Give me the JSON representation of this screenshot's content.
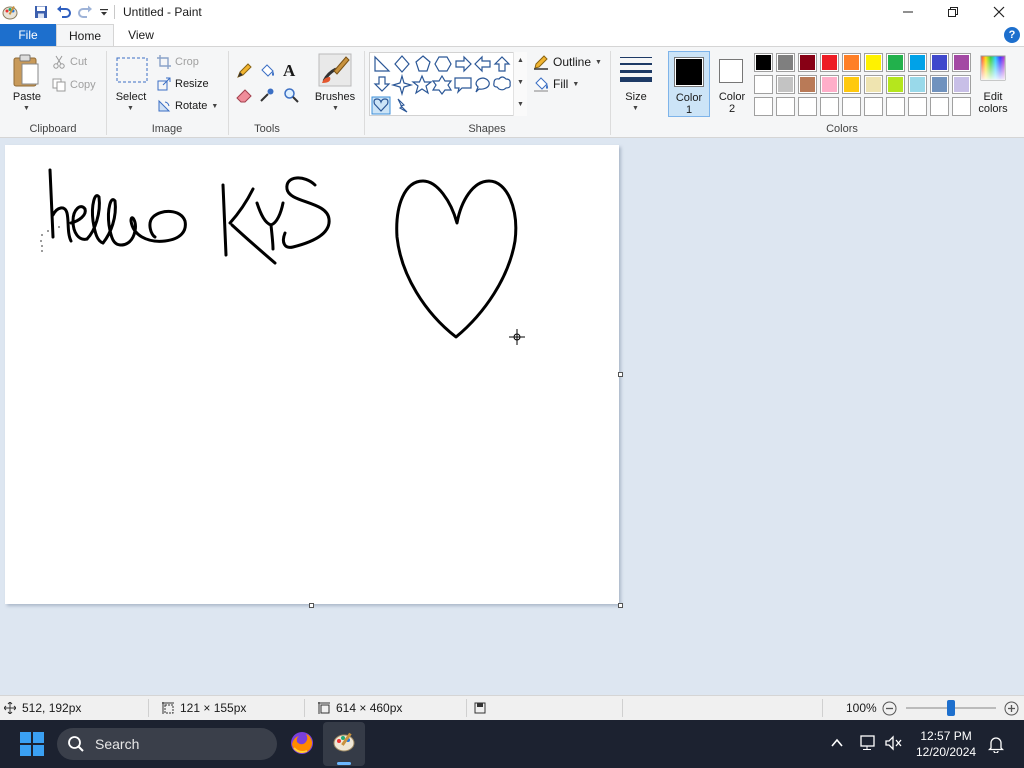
{
  "window": {
    "title": "Untitled - Paint",
    "controls": [
      "minimize",
      "maximize",
      "close"
    ]
  },
  "quick_access": [
    "save-icon",
    "undo-icon",
    "redo-icon",
    "customize-icon"
  ],
  "tabs": {
    "file": "File",
    "home": "Home",
    "view": "View",
    "active": "Home",
    "help": "?"
  },
  "ribbon": {
    "clipboard": {
      "label": "Clipboard",
      "paste": "Paste",
      "cut": "Cut",
      "copy": "Copy"
    },
    "image": {
      "label": "Image",
      "select": "Select",
      "crop": "Crop",
      "resize": "Resize",
      "rotate": "Rotate"
    },
    "tools": {
      "label": "Tools",
      "items": [
        "pencil-icon",
        "fill-icon",
        "text-icon",
        "eraser-icon",
        "color-picker-icon",
        "magnifier-icon"
      ]
    },
    "brushes": {
      "label": "Brushes"
    },
    "shapes": {
      "label": "Shapes",
      "outline": "Outline",
      "fill": "Fill",
      "selected": "heart-shape"
    },
    "size": {
      "label": "Size"
    },
    "color1": {
      "label_line1": "Color",
      "label_line2": "1",
      "value": "#000000"
    },
    "color2": {
      "label_line1": "Color",
      "label_line2": "2",
      "value": "#ffffff"
    },
    "colors": {
      "label": "Colors",
      "row1": [
        "#000000",
        "#7f7f7f",
        "#880015",
        "#ed1c24",
        "#ff7f27",
        "#fff200",
        "#22b14c",
        "#00a2e8",
        "#3f48cc",
        "#a349a4"
      ],
      "row2": [
        "#ffffff",
        "#c3c3c3",
        "#b97a57",
        "#ffaec9",
        "#ffc90e",
        "#efe4b0",
        "#b5e61d",
        "#99d9ea",
        "#7092be",
        "#c8bfe7"
      ],
      "row3": [
        "",
        "",
        "",
        "",
        "",
        "",
        "",
        "",
        "",
        ""
      ]
    },
    "edit_colors": {
      "line1": "Edit",
      "line2": "colors"
    }
  },
  "canvas_content": {
    "drawn_text": "hello KYS",
    "drawn_shape": "heart"
  },
  "status": {
    "cursor_position": "512, 192px",
    "selection_size": "121 × 155px",
    "canvas_size": "614 × 460px",
    "zoom": "100%",
    "zoom_level": 1.0
  },
  "taskbar": {
    "search_placeholder": "Search",
    "time": "12:57 PM",
    "date": "12/20/2024"
  }
}
